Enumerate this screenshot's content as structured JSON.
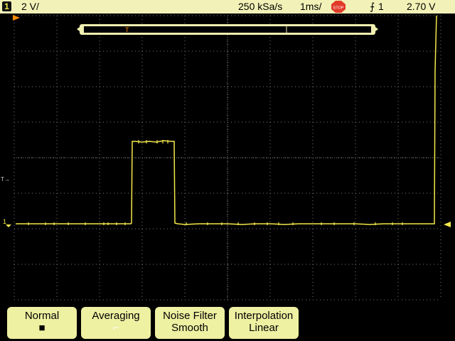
{
  "status_bar": {
    "channel_number": "1",
    "volts_per_div": "2 V/",
    "sample_rate": "250 kSa/s",
    "time_per_div": "1ms/",
    "run_state": "STOP",
    "trigger_source": "1",
    "trigger_level": "2.70 V"
  },
  "colors": {
    "trace": "#f4e84a",
    "grid": "#7a7a7a",
    "marker": "#ff8c00",
    "softkey_bg": "#eef0a2",
    "topbar_bg": "#f2f2b8"
  },
  "screen": {
    "trigger_marker_label": "T",
    "left_trigger_label": "T",
    "channel_ground_label": "1"
  },
  "softkeys": [
    {
      "title": "Normal",
      "value": "■"
    },
    {
      "title": "Averaging",
      "value": "⌐"
    },
    {
      "title": "Noise Filter",
      "value": "Smooth"
    },
    {
      "title": "Interpolation",
      "value": "Linear"
    }
  ]
}
